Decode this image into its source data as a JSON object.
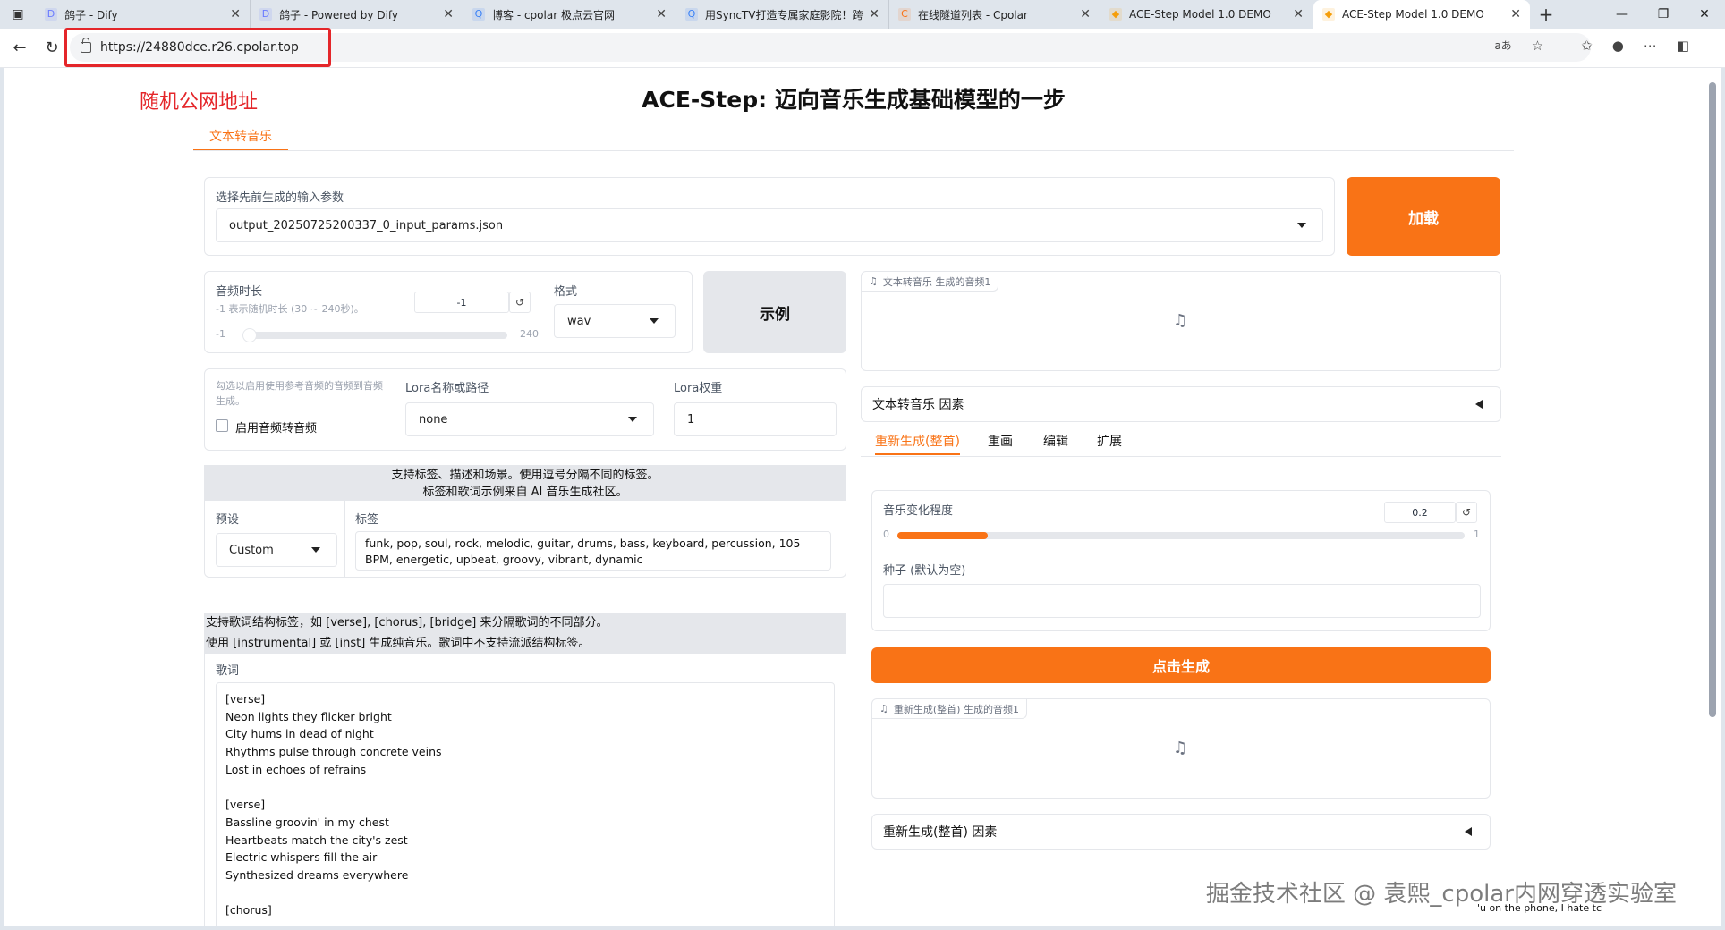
{
  "browser": {
    "tabs": [
      {
        "title": "鸽子 - Dify",
        "fav": "D",
        "favcolor": "#6b7cff",
        "width": 240
      },
      {
        "title": "鸽子 - Powered by Dify",
        "fav": "D",
        "favcolor": "#6b7cff",
        "width": 238
      },
      {
        "title": "博客 - cpolar 极点云官网",
        "fav": "Q",
        "favcolor": "#3b82f6",
        "width": 238
      },
      {
        "title": "用SyncTV打造专属家庭影院！跨",
        "fav": "Q",
        "favcolor": "#3b82f6",
        "width": 238
      },
      {
        "title": "在线隧道列表 - Cpolar",
        "fav": "C",
        "favcolor": "#f97316",
        "width": 236
      },
      {
        "title": "ACE-Step Model 1.0 DEMO",
        "fav": "◆",
        "favcolor": "#f59e0b",
        "width": 238
      },
      {
        "title": "ACE-Step Model 1.0 DEMO",
        "fav": "◆",
        "favcolor": "#f59e0b",
        "width": 242,
        "active": true
      }
    ],
    "url": "https://24880dce.r26.cpolar.top",
    "annotation": "随机公网地址"
  },
  "page": {
    "title": "ACE-Step: 迈向音乐生成基础模型的一步",
    "main_tab": "文本转音乐",
    "params": {
      "label": "选择先前生成的输入参数",
      "value": "output_20250725200337_0_input_params.json",
      "load_button": "加载"
    },
    "duration": {
      "label": "音频时长",
      "hint": "-1 表示随机时长 (30 ~ 240秒)。",
      "value": "-1",
      "min": "-1",
      "max": "240",
      "reset": "↺"
    },
    "format": {
      "label": "格式",
      "value": "wav"
    },
    "example_button": "示例",
    "audio2audio": {
      "hint": "勾选以启用使用参考音频的音频到音频生成。",
      "checkbox_label": "启用音频转音频"
    },
    "lora": {
      "label": "Lora名称或路径",
      "value": "none",
      "weight_label": "Lora权重",
      "weight_value": "1"
    },
    "tags_info": {
      "line1": "支持标签、描述和场景。使用逗号分隔不同的标签。",
      "line2": "标签和歌词示例来自 AI 音乐生成社区。"
    },
    "preset": {
      "label": "预设",
      "value": "Custom"
    },
    "tags": {
      "label": "标签",
      "value": "funk, pop, soul, rock, melodic, guitar, drums, bass, keyboard, percussion, 105 BPM, energetic, upbeat, groovy, vibrant, dynamic"
    },
    "lyrics_info": {
      "line1": "支持歌词结构标签，如 [verse], [chorus], [bridge] 来分隔歌词的不同部分。",
      "line2": "使用 [instrumental] 或 [inst] 生成纯音乐。歌词中不支持流派结构标签。"
    },
    "lyrics": {
      "label": "歌词",
      "lines": [
        "[verse]",
        "Neon lights they flicker bright",
        "City hums in dead of night",
        "Rhythms pulse through concrete veins",
        "Lost in echoes of refrains",
        "",
        "[verse]",
        "Bassline groovin' in my chest",
        "Heartbeats match the city's zest",
        "Electric whispers fill the air",
        "Synthesized dreams everywhere",
        "",
        "[chorus]"
      ]
    },
    "output_audio1": {
      "chip": "文本转音乐 生成的音频1"
    },
    "factors_accordion": "文本转音乐 因素",
    "subtabs": [
      "重新生成(整首)",
      "重画",
      "编辑",
      "扩展"
    ],
    "variation": {
      "label": "音乐变化程度",
      "value": "0.2",
      "min": "0",
      "max": "1",
      "reset": "↺",
      "level": 0.2
    },
    "seed": {
      "label": "种子 (默认为空)",
      "value": ""
    },
    "generate_button": "点击生成",
    "output_audio2": {
      "chip": "重新生成(整首) 生成的音频1"
    },
    "regen_accordion": "重新生成(整首) 因素"
  },
  "watermark": "掘金技术社区 @ 袁熙_cpolar内网穿透实验室",
  "watermark_sub": "'u on the phone, I hate tc",
  "icons": {
    "music": "music-note-icon",
    "audio_chip": "music-note-small-icon"
  },
  "colors": {
    "accent": "#f97316",
    "annotation_red": "#e4262a"
  }
}
